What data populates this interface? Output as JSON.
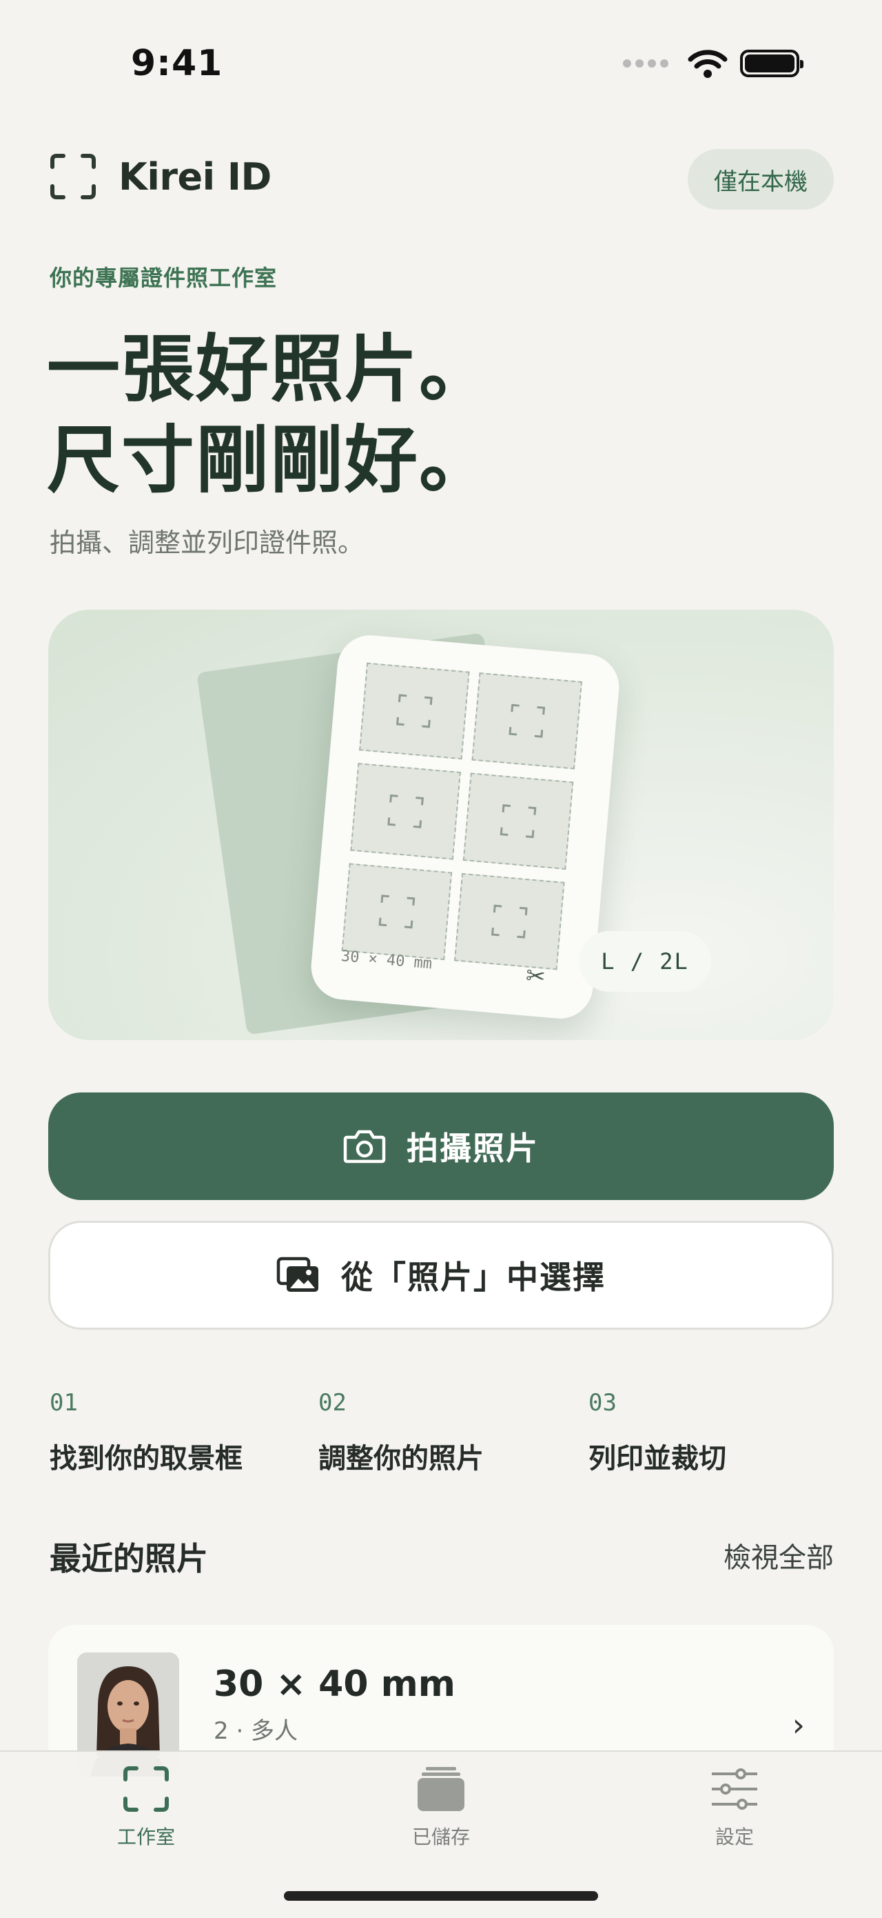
{
  "status_bar": {
    "time": "9:41"
  },
  "header": {
    "brand": "Kirei ID",
    "local_chip": "僅在本機"
  },
  "hero": {
    "eyebrow": "你的專屬證件照工作室",
    "headline_line1": "一張好照片。",
    "headline_line2": "尺寸剛剛好。",
    "subline": "拍攝、調整並列印證件照。",
    "sheet_caption": "30 × 40 mm",
    "print_size_badge": "L / 2L"
  },
  "actions": {
    "take_photo": "拍攝照片",
    "choose_from_photos": "從「照片」中選擇"
  },
  "steps": [
    {
      "num": "01",
      "label": "找到你的取景框"
    },
    {
      "num": "02",
      "label": "調整你的照片"
    },
    {
      "num": "03",
      "label": "列印並裁切"
    }
  ],
  "recent": {
    "title": "最近的照片",
    "view_all": "檢視全部",
    "items": [
      {
        "size": "30 × 40 mm",
        "meta": "2 · 多人"
      }
    ]
  },
  "tabbar": {
    "tabs": [
      {
        "label": "工作室",
        "icon": "viewfinder-icon",
        "active": true
      },
      {
        "label": "已儲存",
        "icon": "stack-icon",
        "active": false
      },
      {
        "label": "設定",
        "icon": "sliders-icon",
        "active": false
      }
    ]
  },
  "colors": {
    "accent": "#416b56",
    "background": "#f4f3ef",
    "brand_green": "#3d7353"
  }
}
